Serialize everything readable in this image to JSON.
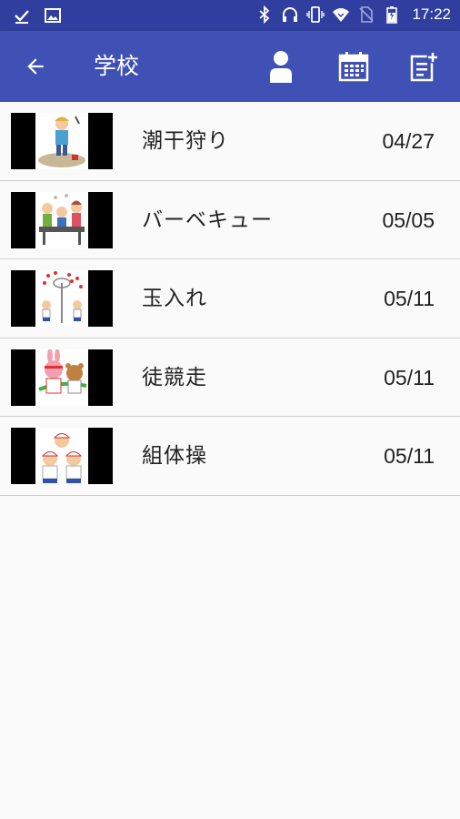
{
  "status_bar": {
    "time": "17:22",
    "left_icons": [
      "download-done-icon",
      "image-icon"
    ],
    "right_icons": [
      "bluetooth-icon",
      "headphones-icon",
      "vibrate-icon",
      "wifi-icon",
      "no-sim-icon",
      "battery-icon"
    ]
  },
  "app_bar": {
    "title": "学校",
    "back_icon": "arrow-back-icon",
    "actions": [
      "person-icon",
      "calendar-icon",
      "add-note-icon"
    ]
  },
  "items": [
    {
      "name": "潮干狩り",
      "date": "04/27",
      "thumbnail_icon": "clam-digging-illustration"
    },
    {
      "name": "バーベキュー",
      "date": "05/05",
      "thumbnail_icon": "barbecue-illustration"
    },
    {
      "name": "玉入れ",
      "date": "05/11",
      "thumbnail_icon": "ball-toss-illustration"
    },
    {
      "name": "徒競走",
      "date": "05/11",
      "thumbnail_icon": "footrace-illustration"
    },
    {
      "name": "組体操",
      "date": "05/11",
      "thumbnail_icon": "gymnastics-pyramid-illustration"
    }
  ],
  "colors": {
    "status_bar": "#303f9f",
    "app_bar": "#3f51b5",
    "background": "#fafafa",
    "divider": "#cfcfcf"
  }
}
